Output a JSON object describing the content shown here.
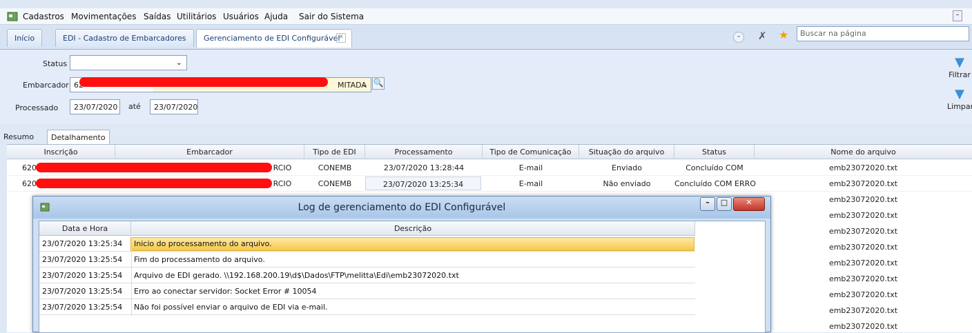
{
  "menu": {
    "items": [
      "Cadastros",
      "Movimentações",
      "Saídas",
      "Utilitários",
      "Usuários",
      "Ajuda",
      "Sair do Sistema"
    ]
  },
  "tabs": {
    "items": [
      "Início",
      "EDI - Cadastro de Embarcadores",
      "Gerenciamento de EDI Configurável"
    ],
    "search_placeholder": "Buscar na página"
  },
  "filter": {
    "status_label": "Status",
    "status_value": "",
    "embarcador_label": "Embarcador",
    "embarcador_code": "62",
    "embarcador_name_suffix": "MITADA",
    "processado_label": "Processado",
    "date_from": "23/07/2020",
    "ate_label": "até",
    "date_to": "23/07/2020",
    "filtrar_label": "Filtrar",
    "limpar_label": "Limpar"
  },
  "subtabs": [
    "Resumo",
    "Detalhamento"
  ],
  "grid": {
    "columns": [
      "Inscrição",
      "Embarcador",
      "Tipo de EDI",
      "Processamento",
      "Tipo de Comunicação",
      "Situação do arquivo",
      "Status",
      "Nome do arquivo"
    ],
    "rows": [
      {
        "inscricao": "620",
        "embarcador": "RCIO",
        "tipo": "CONEMB",
        "processamento": "23/07/2020 13:28:44",
        "comunicacao": "E-mail",
        "situacao": "Enviado",
        "status": "Concluído COM",
        "arquivo": "emb23072020.txt"
      },
      {
        "inscricao": "620",
        "embarcador": "RCIO",
        "tipo": "CONEMB",
        "processamento": "23/07/2020 13:25:34",
        "comunicacao": "E-mail",
        "situacao": "Não enviado",
        "status": "Concluído COM ERRO",
        "arquivo": "emb23072020.txt"
      }
    ],
    "extra_files": [
      "emb23072020.txt",
      "emb23072020.txt",
      "emb23072020.txt",
      "emb23072020.txt",
      "emb23072020.txt",
      "emb23072020.txt",
      "emb23072020.txt",
      "emb23072020.txt",
      "emb23072020.txt"
    ]
  },
  "dialog": {
    "title": "Log de gerenciamento do EDI Configurável",
    "columns": [
      "Data e Hora",
      "Descrição"
    ],
    "rows": [
      {
        "datetime": "23/07/2020 13:25:34",
        "desc": "Inicio do processamento do arquivo."
      },
      {
        "datetime": "23/07/2020 13:25:54",
        "desc": "Fim do processamento do arquivo."
      },
      {
        "datetime": "23/07/2020 13:25:54",
        "desc": "Arquivo de EDI gerado. \\\\192.168.200.19\\d$\\Dados\\FTP\\melitta\\Edi\\emb23072020.txt"
      },
      {
        "datetime": "23/07/2020 13:25:54",
        "desc": "Erro ao conectar servidor: Socket Error # 10054"
      },
      {
        "datetime": "23/07/2020 13:25:54",
        "desc": "Não foi possível enviar o arquivo de EDI via e-mail."
      }
    ]
  },
  "colors": {
    "redaction": "#ff1010",
    "selected_row": "#fbd96e",
    "accent": "#1a3f73"
  },
  "icons": [
    "app-icon",
    "close-tab-icon",
    "chevron-down-icon",
    "pin-icon",
    "star-icon",
    "search-icon",
    "filter-icon",
    "clear-filter-icon",
    "minimize-icon",
    "maximize-icon",
    "close-icon"
  ]
}
